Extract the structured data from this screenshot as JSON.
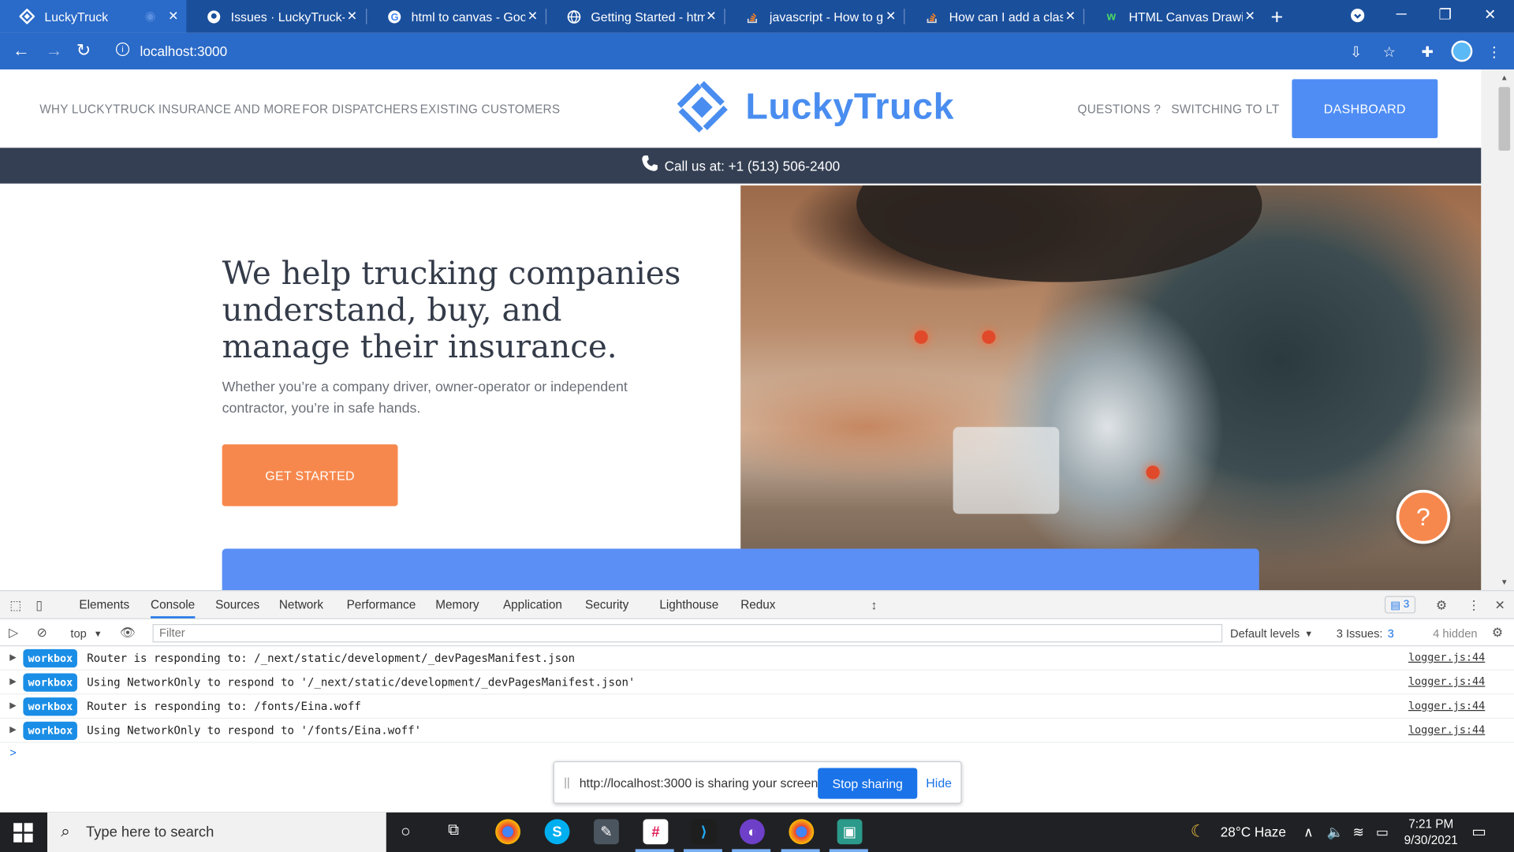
{
  "browser": {
    "tabs": [
      {
        "label": "LuckyTruck",
        "favicon": "luckytruck-favicon-icon",
        "active": true
      },
      {
        "label": "Issues · LuckyTruck-co",
        "favicon": "github-icon"
      },
      {
        "label": "html to canvas - Goog",
        "favicon": "google-icon"
      },
      {
        "label": "Getting Started - html",
        "favicon": "globe-icon"
      },
      {
        "label": "javascript - How to ge",
        "favicon": "stackoverflow-icon"
      },
      {
        "label": "How can I add a class",
        "favicon": "stackoverflow-icon"
      },
      {
        "label": "HTML Canvas Drawing",
        "favicon": "w3schools-icon"
      }
    ],
    "url": "localhost:3000"
  },
  "site": {
    "nav_left": [
      "WHY LUCKYTRUCK",
      "INSURANCE AND MORE",
      "FOR DISPATCHERS",
      "EXISTING CUSTOMERS"
    ],
    "logo_text": "LuckyTruck",
    "nav_right": [
      "QUESTIONS ?",
      "SWITCHING TO LT"
    ],
    "dashboard_label": "DASHBOARD",
    "call_text": "Call us at: +1 (513) 506-2400",
    "hero_title": "We help trucking companies understand, buy, and manage their insurance.",
    "hero_subtitle": "Whether you’re a company driver, owner-operator or independent contractor, you’re in safe hands.",
    "cta_label": "GET STARTED",
    "help_label": "?",
    "colors": {
      "brand_blue": "#4a8df0",
      "cta_orange": "#f7884d",
      "callbar": "#343f53"
    }
  },
  "devtools": {
    "tabs": [
      "Elements",
      "Console",
      "Sources",
      "Network",
      "Performance",
      "Memory",
      "Application",
      "Security",
      "Lighthouse",
      "Redux"
    ],
    "active_tab": "Console",
    "issues_badge": "3",
    "context": "top",
    "filter_placeholder": "Filter",
    "levels": "Default levels",
    "issues_text": "3 Issues:",
    "issues_count": "3",
    "hidden_text": "4 hidden",
    "logs": [
      {
        "badge": "workbox",
        "message": "Router is responding to: /_next/static/development/_devPagesManifest.json",
        "source": "logger.js:44"
      },
      {
        "badge": "workbox",
        "message": "Using NetworkOnly to respond to '/_next/static/development/_devPagesManifest.json'",
        "source": "logger.js:44"
      },
      {
        "badge": "workbox",
        "message": "Router is responding to: /fonts/Eina.woff",
        "source": "logger.js:44"
      },
      {
        "badge": "workbox",
        "message": "Using NetworkOnly to respond to '/fonts/Eina.woff'",
        "source": "logger.js:44"
      }
    ],
    "prompt": ">"
  },
  "share_bar": {
    "text": "http://localhost:3000 is sharing your screen.",
    "stop_label": "Stop sharing",
    "hide_label": "Hide"
  },
  "taskbar": {
    "search_placeholder": "Type here to search",
    "weather": "28°C  Haze",
    "time": "7:21 PM",
    "date": "9/30/2021"
  }
}
